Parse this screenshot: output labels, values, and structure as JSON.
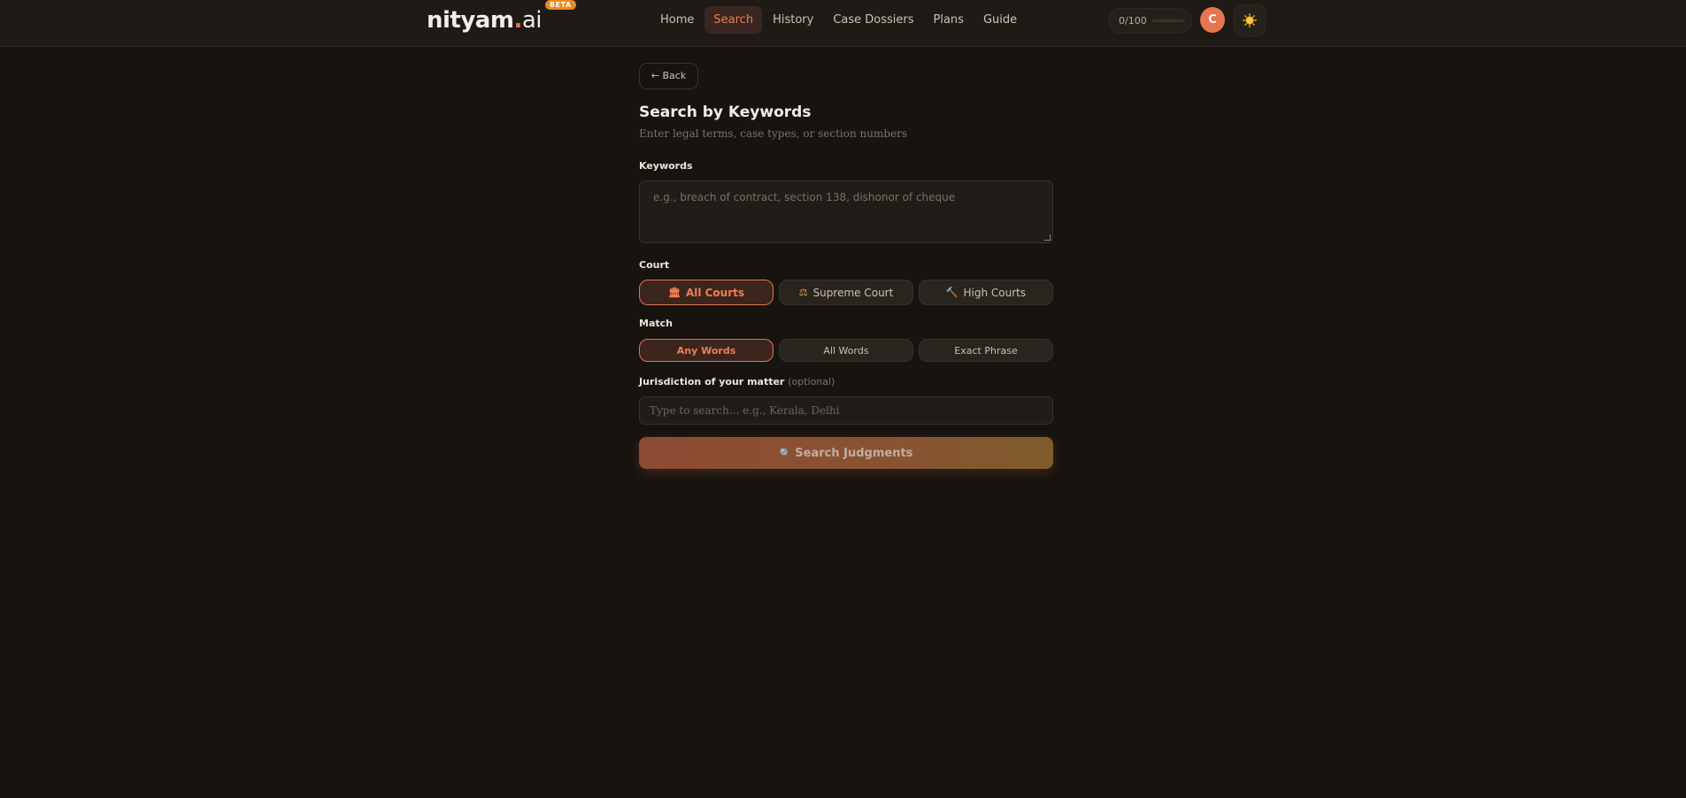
{
  "header": {
    "logo_main": "nityam",
    "logo_dot": ".",
    "logo_ai": "ai",
    "beta_badge": "BETA",
    "nav": [
      {
        "label": "Home",
        "active": false
      },
      {
        "label": "Search",
        "active": true
      },
      {
        "label": "History",
        "active": false
      },
      {
        "label": "Case Dossiers",
        "active": false
      },
      {
        "label": "Plans",
        "active": false
      },
      {
        "label": "Guide",
        "active": false
      }
    ],
    "usage_text": "0/100",
    "usage_fraction": 0,
    "avatar_initial": "C",
    "theme_icon": "sun-icon"
  },
  "page": {
    "back_label": "← Back",
    "title": "Search by Keywords",
    "subtitle": "Enter legal terms, case types, or section numbers",
    "keywords_label": "Keywords",
    "keywords_placeholder": "e.g., breach of contract, section 138, dishonor of cheque",
    "court_label": "Court",
    "court_options": [
      {
        "icon": "🏛",
        "label": "All Courts",
        "active": true
      },
      {
        "icon": "⚖",
        "label": "Supreme Court",
        "active": false
      },
      {
        "icon": "🔨",
        "label": "High Courts",
        "active": false
      }
    ],
    "match_label": "Match",
    "match_options": [
      {
        "label": "Any Words",
        "active": true
      },
      {
        "label": "All Words",
        "active": false
      },
      {
        "label": "Exact Phrase",
        "active": false
      }
    ],
    "jurisdiction_label": "Jurisdiction of your matter",
    "jurisdiction_optional": "(optional)",
    "jurisdiction_placeholder": "Type to search... e.g., Kerala, Delhi",
    "search_button_icon": "🔍",
    "search_button_label": "Search Judgments"
  },
  "colors": {
    "accent": "#e8734d",
    "background": "#17130f",
    "beta": "#e9891e"
  }
}
